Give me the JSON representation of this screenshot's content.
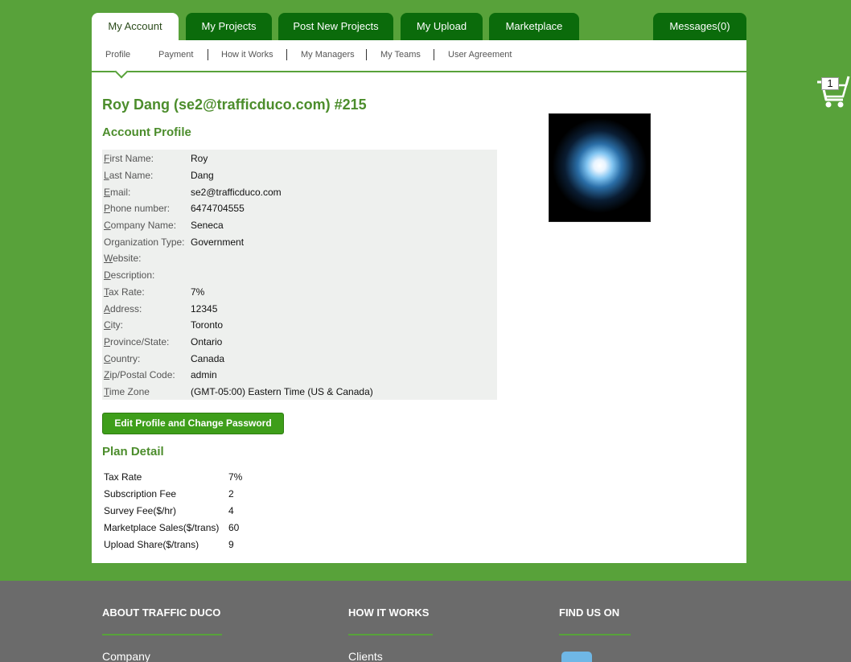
{
  "tabs": {
    "my_account": "My Account",
    "my_projects": "My Projects",
    "post_new_projects": "Post New Projects",
    "my_upload": "My Upload",
    "marketplace": "Marketplace",
    "messages": "Messages(0)"
  },
  "subnav": {
    "profile": "Profile",
    "payment": "Payment",
    "how_it_works": "How it Works",
    "my_managers": "My Managers",
    "my_teams": "My Teams",
    "user_agreement": "User Agreement"
  },
  "page_title": "Roy Dang (se2@trafficduco.com) #215",
  "account_profile": {
    "heading": "Account Profile",
    "rows": [
      {
        "first": "F",
        "rest": "irst Name:",
        "value": "Roy"
      },
      {
        "first": "L",
        "rest": "ast Name:",
        "value": "Dang"
      },
      {
        "first": "E",
        "rest": "mail:",
        "value": "se2@trafficduco.com"
      },
      {
        "first": "P",
        "rest": "hone number:",
        "value": "6474704555"
      },
      {
        "first": "C",
        "rest": "ompany Name:",
        "value": "Seneca"
      },
      {
        "first": "",
        "rest": "Organization Type:",
        "value": "Government"
      },
      {
        "first": "W",
        "rest": "ebsite:",
        "value": ""
      },
      {
        "first": "D",
        "rest": "escription:",
        "value": ""
      },
      {
        "first": "T",
        "rest": "ax Rate:",
        "value": "7%"
      },
      {
        "first": "A",
        "rest": "ddress:",
        "value": "12345"
      },
      {
        "first": "C",
        "rest": "ity:",
        "value": "Toronto"
      },
      {
        "first": "P",
        "rest": "rovince/State:",
        "value": "Ontario"
      },
      {
        "first": "C",
        "rest": "ountry:",
        "value": "Canada"
      },
      {
        "first": "Z",
        "rest": "ip/Postal Code:",
        "value": "admin"
      },
      {
        "first": "T",
        "rest": "ime Zone",
        "value": "(GMT-05:00) Eastern Time (US & Canada)"
      }
    ]
  },
  "edit_button": "Edit Profile and Change Password",
  "plan_detail": {
    "heading": "Plan Detail",
    "rows": [
      {
        "label": "Tax Rate",
        "value": "7%"
      },
      {
        "label": "Subscription Fee",
        "value": "2"
      },
      {
        "label": "Survey Fee($/hr)",
        "value": "4"
      },
      {
        "label": "Marketplace Sales($/trans)",
        "value": "60"
      },
      {
        "label": "Upload Share($/trans)",
        "value": "9"
      }
    ]
  },
  "cart": {
    "count": "1",
    "icon": "shopping-cart-icon"
  },
  "footer": {
    "about_title": "ABOUT TRAFFIC DUCO",
    "how_title": "HOW IT WORKS",
    "find_title": "FIND US ON",
    "about_link": "Company",
    "how_link": "Clients"
  }
}
